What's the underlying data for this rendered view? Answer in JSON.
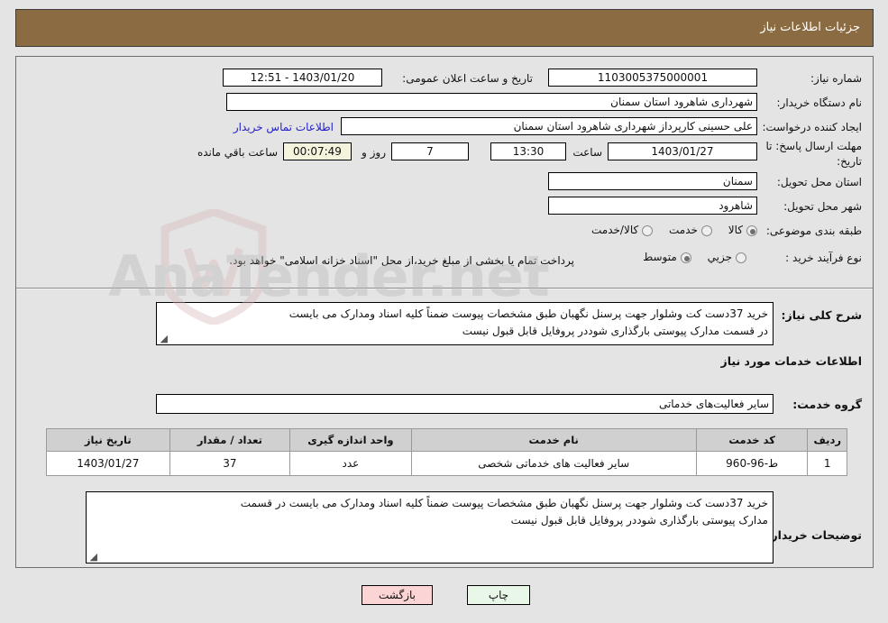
{
  "header": {
    "title": "جزئیات اطلاعات نیاز",
    "bar_color": "#8b6b42"
  },
  "watermark": {
    "text": "AnaTender.net"
  },
  "form": {
    "need_number_label": "شماره نیاز:",
    "need_number_value": "1103005375000001",
    "public_announce_label": "تاریخ و ساعت اعلان عمومی:",
    "public_announce_value": "1403/01/20 - 12:51",
    "buyer_org_label": "نام دستگاه خریدار:",
    "buyer_org_value": "شهرداری شاهرود استان سمنان",
    "requester_label": "ایجاد کننده درخواست:",
    "requester_value": "علی حسینی کارپرداز شهرداری شاهرود استان سمنان",
    "contact_link": "اطلاعات تماس خریدار",
    "deadline_label": "مهلت ارسال پاسخ: تا تاریخ:",
    "deadline_date": "1403/01/27",
    "deadline_time_label": "ساعت",
    "deadline_time": "13:30",
    "days_value": "7",
    "days_unit_label": "روز و",
    "countdown_value": "00:07:49",
    "countdown_suffix": "ساعت باقي مانده",
    "province_label": "استان محل تحویل:",
    "province_value": "سمنان",
    "city_label": "شهر محل تحویل:",
    "city_value": "شاهرود",
    "category_label": "طبقه بندی موضوعی:",
    "category_options": [
      {
        "label": "کالا",
        "selected": false
      },
      {
        "label": "خدمت",
        "selected": true
      },
      {
        "label": "کالا/خدمت",
        "selected": false
      }
    ],
    "process_label": "نوع فرآیند خرید :",
    "process_options": [
      {
        "label": "جزیي",
        "selected": false
      },
      {
        "label": "متوسط",
        "selected": true
      }
    ],
    "process_note": "پرداخت تمام یا بخشی از مبلغ خرید،از محل \"اسناد خزانه اسلامی\" خواهد بود."
  },
  "summary": {
    "label": "شرح کلی نیاز:",
    "line1": "خرید 37دست کت وشلوار  جهت پرسنل نگهبان طبق مشخصات پیوست ضمناً کلیه اسناد ومدارک می بایست",
    "line2": "در قسمت مدارک پیوستی بارگذاری شوددر پروفایل قابل قبول نیست"
  },
  "services_section": {
    "heading": "اطلاعات خدمات مورد نیاز",
    "group_label": "گروه خدمت:",
    "group_value": "سایر فعالیت‌های خدماتی",
    "table": {
      "columns": [
        "ردیف",
        "کد خدمت",
        "نام خدمت",
        "واحد اندازه گیری",
        "تعداد / مقدار",
        "تاریخ نیاز"
      ],
      "rows": [
        [
          "1",
          "ط-96-960",
          "سایر فعالیت های خدماتی شخصی",
          "عدد",
          "37",
          "1403/01/27"
        ]
      ]
    }
  },
  "buyer_notes": {
    "label": "توضیحات خریدار:",
    "line1": "خرید 37دست کت وشلوار  جهت پرسنل نگهبان طبق مشخصات پیوست ضمناً کلیه اسناد ومدارک می بایست در قسمت",
    "line2": "مدارک پیوستی بارگذاری شوددر پروفایل قابل قبول نیست"
  },
  "footer": {
    "print_label": "چاپ",
    "back_label": "بازگشت"
  }
}
